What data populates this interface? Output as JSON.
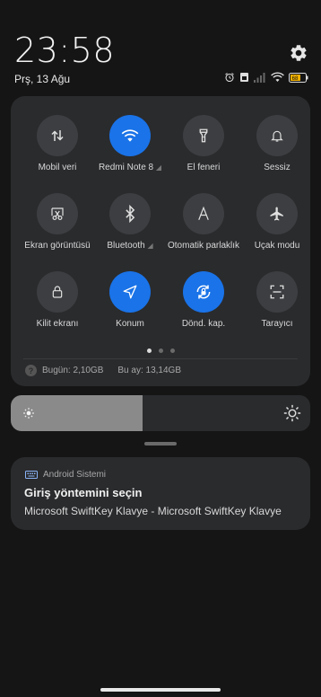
{
  "status_bar": {
    "time": "23:58",
    "date": "Prş, 13 Ağu",
    "battery_level": "68",
    "icons": [
      "alarm-icon",
      "sim-icon",
      "signal-icon",
      "wifi-icon",
      "battery-icon"
    ]
  },
  "quick_settings": {
    "tiles": [
      {
        "id": "mobile-data",
        "label": "Mobil veri",
        "icon": "mobile-data-icon",
        "active": false
      },
      {
        "id": "wifi",
        "label": "Redmi Note 8",
        "icon": "wifi-icon",
        "active": true
      },
      {
        "id": "flashlight",
        "label": "El feneri",
        "icon": "flashlight-icon",
        "active": false
      },
      {
        "id": "silent",
        "label": "Sessiz",
        "icon": "bell-icon",
        "active": false
      },
      {
        "id": "screenshot",
        "label": "Ekran görüntüsü",
        "icon": "scissors-icon",
        "active": false
      },
      {
        "id": "bluetooth",
        "label": "Bluetooth",
        "icon": "bluetooth-icon",
        "active": false
      },
      {
        "id": "auto-brightness",
        "label": "Otomatik parlaklık",
        "icon": "auto-brightness-icon",
        "active": false
      },
      {
        "id": "airplane",
        "label": "Uçak modu",
        "icon": "airplane-icon",
        "active": false
      },
      {
        "id": "lock-screen",
        "label": "Kilit ekranı",
        "icon": "lock-icon",
        "active": false
      },
      {
        "id": "location",
        "label": "Konum",
        "icon": "location-arrow-icon",
        "active": true
      },
      {
        "id": "rotation",
        "label": "Dönd. kap.",
        "icon": "rotation-lock-icon",
        "active": true
      },
      {
        "id": "scanner",
        "label": "Tarayıcı",
        "icon": "scanner-icon",
        "active": false
      }
    ],
    "page_count": 3,
    "current_page": 1,
    "data_usage": {
      "today": "Bugün: 2,10GB",
      "month": "Bu ay: 13,14GB"
    }
  },
  "brightness": {
    "level": 0.44
  },
  "notification": {
    "app_name": "Android Sistemi",
    "title": "Giriş yöntemini seçin",
    "text": "Microsoft SwiftKey Klavye - Microsoft SwiftKey Klavye"
  },
  "colors": {
    "accent": "#1a73e8",
    "panel": "#2a2b2d",
    "background": "#151515"
  }
}
